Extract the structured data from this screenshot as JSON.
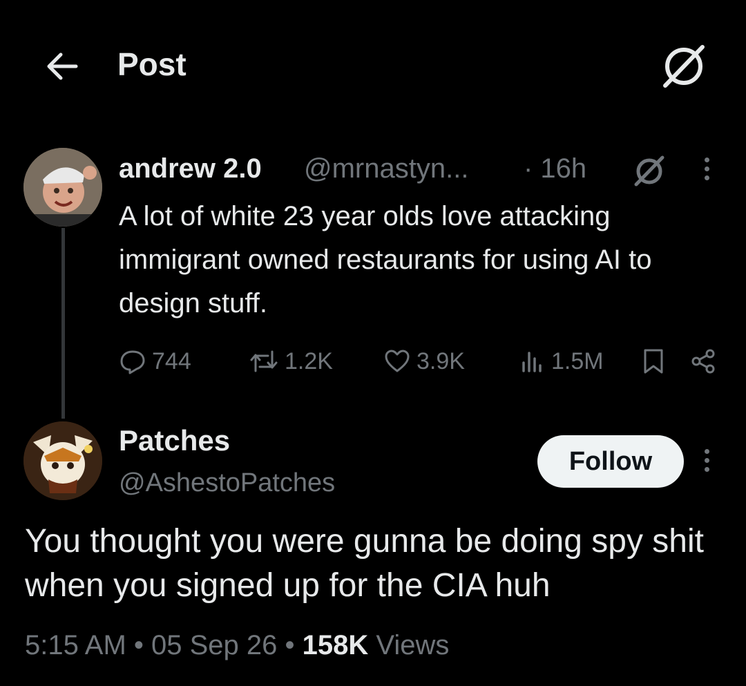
{
  "header": {
    "title": "Post"
  },
  "quoted": {
    "name": "andrew 2.0",
    "handle": "@mrnastyn...",
    "time": "· 16h",
    "text": "A lot of white 23 year olds love attacking immigrant owned restaurants for using AI to design stuff.",
    "stats": {
      "replies": "744",
      "reposts": "1.2K",
      "likes": "3.9K",
      "views": "1.5M"
    }
  },
  "reply": {
    "name": "Patches",
    "handle": "@AshestoPatches",
    "follow_label": "Follow",
    "text": "You thought you were gunna be doing spy shit when you signed up for the CIA huh",
    "time": "5:15 AM",
    "date": "05 Sep 26",
    "views_count": "158K",
    "views_label": "Views"
  },
  "colors": {
    "background": "#000000",
    "text": "#e7e9ea",
    "muted": "#71767b",
    "button": "#eff3f4"
  },
  "icons": [
    "back-arrow-icon",
    "grok-icon",
    "more-icon",
    "reply-icon",
    "repost-icon",
    "like-icon",
    "views-icon",
    "bookmark-icon",
    "share-icon"
  ]
}
